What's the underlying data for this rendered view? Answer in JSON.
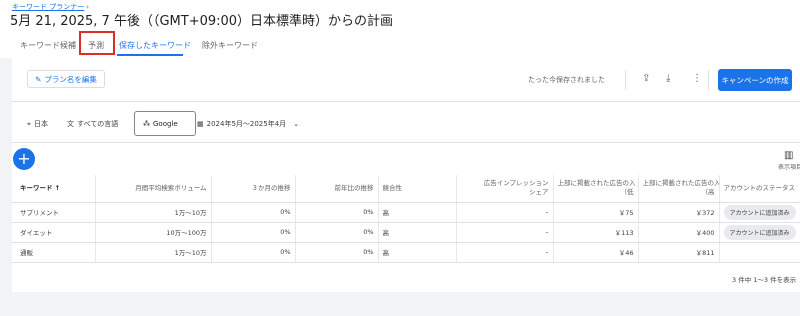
{
  "breadcrumb": "キーワード プランナー",
  "title": "5月 21, 2025, 7 午後（（GMT+09:00）日本標準時）からの計画",
  "tabs": [
    {
      "label": "キーワード候補"
    },
    {
      "label": "予測"
    },
    {
      "label": "保存したキーワード"
    },
    {
      "label": "除外キーワード"
    }
  ],
  "toolbar": {
    "edit_plan_label": "プラン名を編集",
    "saved_status": "たった今保存されました",
    "create_campaign_label": "キャンペーンの作成"
  },
  "filters": {
    "location": "日本",
    "language": "すべての言語",
    "network": "Google",
    "date_range": "2024年5月～2025年4月"
  },
  "columns_label": "表示項目",
  "table": {
    "headers": [
      "キーワード",
      "月間平均検索ボリューム",
      "3 か月の推移",
      "前年比の推移",
      "競合性",
      "広告インプレッション\nシェア",
      "ページ上部に掲載された広告の入札単価（低",
      "ページ上部に掲載された広告の入札単価（高",
      "アカウントのステータス"
    ],
    "header_display": [
      "キーワード",
      "月間平均検索ボリューム",
      "３か月の推移",
      "前年比の推移",
      "競合性",
      "広告インプレッション",
      "上部に掲載された広告の入",
      "上部に掲載された広告の入",
      "アカウントのステータス"
    ],
    "header_display_line2": [
      "",
      "",
      "",
      "",
      "",
      "シェア",
      "（低",
      "（高",
      ""
    ],
    "rows": [
      {
        "keyword": "サプリメント",
        "volume": "1万～10万",
        "three_month": "0%",
        "yoy": "0%",
        "competition": "高",
        "impression_share": "–",
        "bid_low": "￥75",
        "bid_high": "￥372",
        "status": "アカウントに追加済み"
      },
      {
        "keyword": "ダイエット",
        "volume": "10万～100万",
        "three_month": "0%",
        "yoy": "0%",
        "competition": "高",
        "impression_share": "–",
        "bid_low": "￥113",
        "bid_high": "￥400",
        "status": "アカウントに追加済み"
      },
      {
        "keyword": "通販",
        "volume": "1万～10万",
        "three_month": "0%",
        "yoy": "0%",
        "competition": "高",
        "impression_share": "–",
        "bid_low": "￥46",
        "bid_high": "￥811",
        "status": ""
      }
    ]
  },
  "pagination": "3 件中 1～3 件を表示",
  "colors": {
    "accent": "#1a73e8",
    "highlight": "#d93025"
  }
}
